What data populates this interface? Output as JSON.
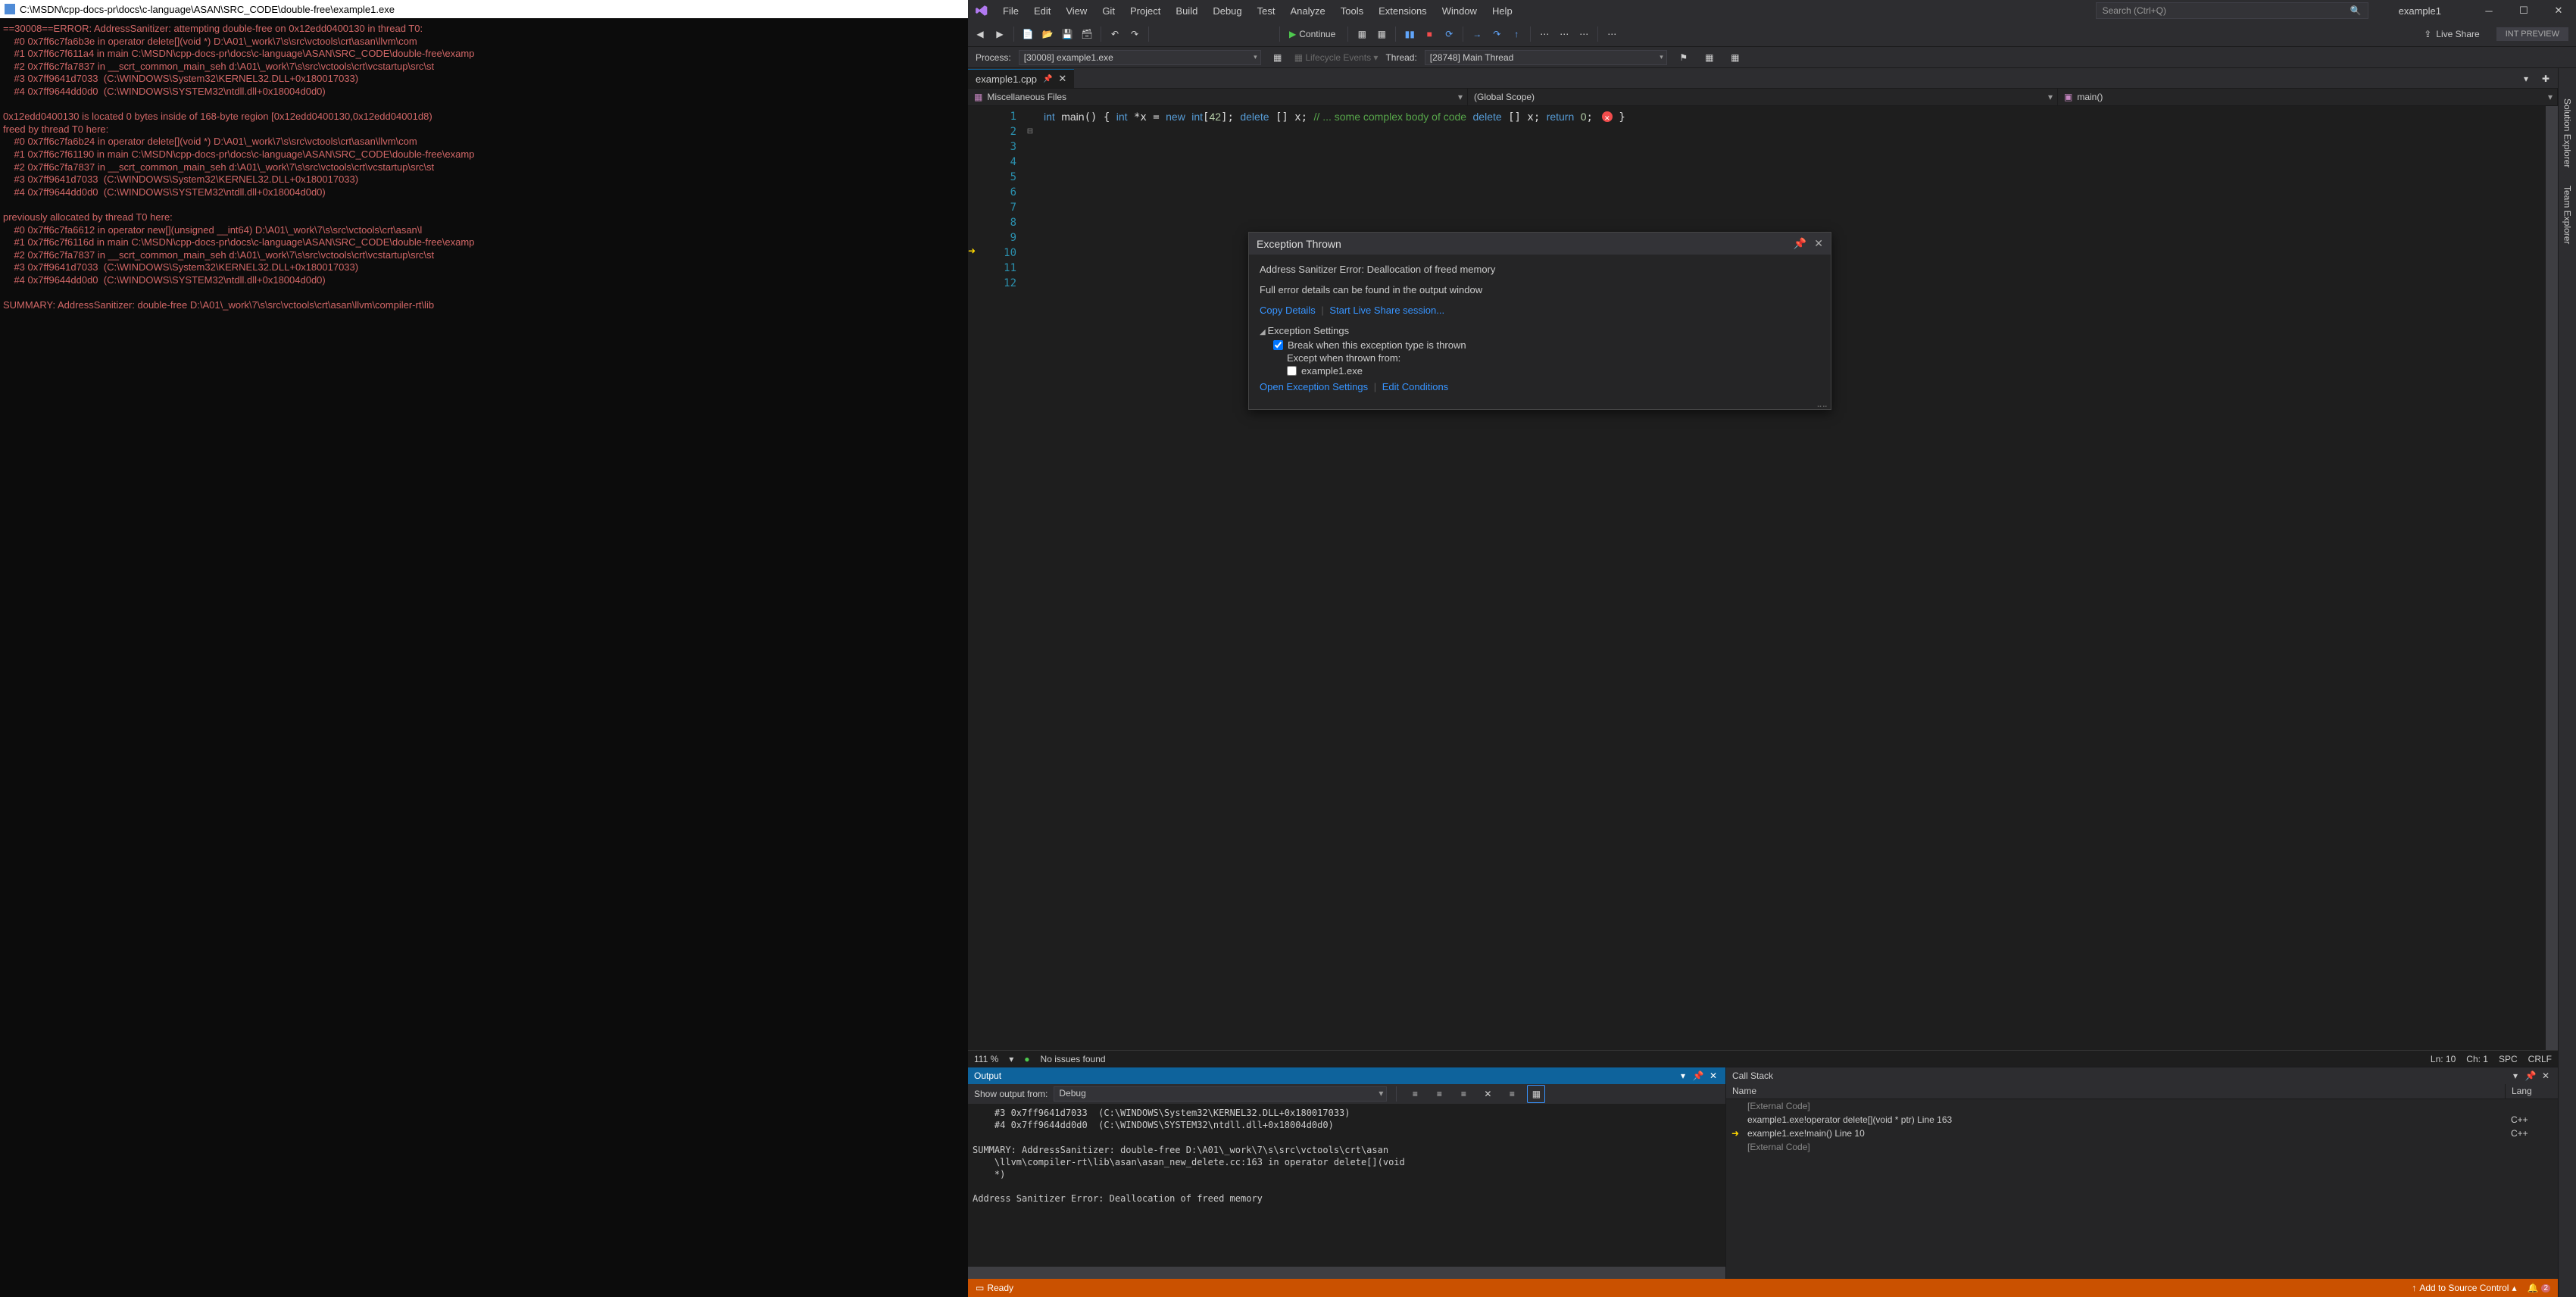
{
  "console": {
    "title": "C:\\MSDN\\cpp-docs-pr\\docs\\c-language\\ASAN\\SRC_CODE\\double-free\\example1.exe",
    "text": "==30008==ERROR: AddressSanitizer: attempting double-free on 0x12edd0400130 in thread T0:\n    #0 0x7ff6c7fa6b3e in operator delete[](void *) D:\\A01\\_work\\7\\s\\src\\vctools\\crt\\asan\\llvm\\com\n    #1 0x7ff6c7f611a4 in main C:\\MSDN\\cpp-docs-pr\\docs\\c-language\\ASAN\\SRC_CODE\\double-free\\examp\n    #2 0x7ff6c7fa7837 in __scrt_common_main_seh d:\\A01\\_work\\7\\s\\src\\vctools\\crt\\vcstartup\\src\\st\n    #3 0x7ff9641d7033  (C:\\WINDOWS\\System32\\KERNEL32.DLL+0x180017033)\n    #4 0x7ff9644dd0d0  (C:\\WINDOWS\\SYSTEM32\\ntdll.dll+0x18004d0d0)\n\n0x12edd0400130 is located 0 bytes inside of 168-byte region [0x12edd0400130,0x12edd04001d8)\nfreed by thread T0 here:\n    #0 0x7ff6c7fa6b24 in operator delete[](void *) D:\\A01\\_work\\7\\s\\src\\vctools\\crt\\asan\\llvm\\com\n    #1 0x7ff6c7f61190 in main C:\\MSDN\\cpp-docs-pr\\docs\\c-language\\ASAN\\SRC_CODE\\double-free\\examp\n    #2 0x7ff6c7fa7837 in __scrt_common_main_seh d:\\A01\\_work\\7\\s\\src\\vctools\\crt\\vcstartup\\src\\st\n    #3 0x7ff9641d7033  (C:\\WINDOWS\\System32\\KERNEL32.DLL+0x180017033)\n    #4 0x7ff9644dd0d0  (C:\\WINDOWS\\SYSTEM32\\ntdll.dll+0x18004d0d0)\n\npreviously allocated by thread T0 here:\n    #0 0x7ff6c7fa6612 in operator new[](unsigned __int64) D:\\A01\\_work\\7\\s\\src\\vctools\\crt\\asan\\l\n    #1 0x7ff6c7f6116d in main C:\\MSDN\\cpp-docs-pr\\docs\\c-language\\ASAN\\SRC_CODE\\double-free\\examp\n    #2 0x7ff6c7fa7837 in __scrt_common_main_seh d:\\A01\\_work\\7\\s\\src\\vctools\\crt\\vcstartup\\src\\st\n    #3 0x7ff9641d7033  (C:\\WINDOWS\\System32\\KERNEL32.DLL+0x180017033)\n    #4 0x7ff9644dd0d0  (C:\\WINDOWS\\SYSTEM32\\ntdll.dll+0x18004d0d0)\n\nSUMMARY: AddressSanitizer: double-free D:\\A01\\_work\\7\\s\\src\\vctools\\crt\\asan\\llvm\\compiler-rt\\lib"
  },
  "menu": {
    "items": [
      "File",
      "Edit",
      "View",
      "Git",
      "Project",
      "Build",
      "Debug",
      "Test",
      "Analyze",
      "Tools",
      "Extensions",
      "Window",
      "Help"
    ]
  },
  "search_placeholder": "Search (Ctrl+Q)",
  "solution_name": "example1",
  "toolbar": {
    "continue": "Continue",
    "liveshare": "Live Share",
    "intpreview": "INT PREVIEW"
  },
  "debugbar": {
    "process_label": "Process:",
    "process": "[30008] example1.exe",
    "lifecycle": "Lifecycle Events",
    "thread_label": "Thread:",
    "thread": "[28748] Main Thread"
  },
  "tab": {
    "name": "example1.cpp"
  },
  "scope": {
    "left": "Miscellaneous Files",
    "mid": "(Global Scope)",
    "right": "main()"
  },
  "code": {
    "lines": [
      "1",
      "2",
      "3",
      "4",
      "5",
      "6",
      "7",
      "8",
      "9",
      "10",
      "11",
      "12"
    ]
  },
  "exception": {
    "title": "Exception Thrown",
    "msg": "Address Sanitizer Error: Deallocation of freed memory",
    "detail": "Full error details can be found in the output window",
    "copy": "Copy Details",
    "share": "Start Live Share session...",
    "settings_head": "Exception Settings",
    "break_label": "Break when this exception type is thrown",
    "except_label": "Except when thrown from:",
    "module": "example1.exe",
    "open_settings": "Open Exception Settings",
    "edit_cond": "Edit Conditions"
  },
  "editor_status": {
    "zoom": "111 %",
    "issues": "No issues found",
    "ln": "Ln: 10",
    "ch": "Ch: 1",
    "spc": "SPC",
    "crlf": "CRLF"
  },
  "output": {
    "title": "Output",
    "show_from": "Show output from:",
    "source": "Debug",
    "text": "    #3 0x7ff9641d7033  (C:\\WINDOWS\\System32\\KERNEL32.DLL+0x180017033)\n    #4 0x7ff9644dd0d0  (C:\\WINDOWS\\SYSTEM32\\ntdll.dll+0x18004d0d0)\n\nSUMMARY: AddressSanitizer: double-free D:\\A01\\_work\\7\\s\\src\\vctools\\crt\\asan\n    \\llvm\\compiler-rt\\lib\\asan\\asan_new_delete.cc:163 in operator delete[](void\n    *)\n\nAddress Sanitizer Error: Deallocation of freed memory"
  },
  "callstack": {
    "title": "Call Stack",
    "col_name": "Name",
    "col_lang": "Lang",
    "rows": [
      {
        "mark": "",
        "name": "[External Code]",
        "lang": "",
        "ext": true
      },
      {
        "mark": "",
        "name": "example1.exe!operator delete[](void * ptr) Line 163",
        "lang": "C++",
        "ext": false
      },
      {
        "mark": "➜",
        "name": "example1.exe!main() Line 10",
        "lang": "C++",
        "ext": false
      },
      {
        "mark": "",
        "name": "[External Code]",
        "lang": "",
        "ext": true
      }
    ]
  },
  "sidetabs": {
    "sol": "Solution Explorer",
    "team": "Team Explorer"
  },
  "status": {
    "ready": "Ready",
    "add_src": "Add to Source Control"
  }
}
